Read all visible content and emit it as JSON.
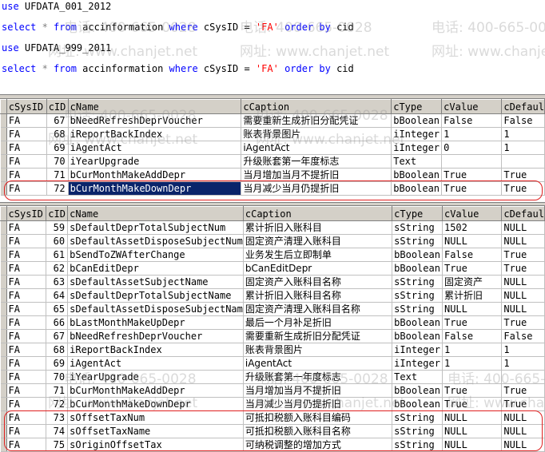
{
  "editor": {
    "lines": [
      {
        "parts": [
          {
            "t": "use",
            "c": "kw"
          },
          {
            "t": " UFDATA_001_2012",
            "c": ""
          }
        ]
      },
      {
        "parts": [
          {
            "t": "select",
            "c": "kw"
          },
          {
            "t": " * ",
            "c": "op"
          },
          {
            "t": "from",
            "c": "kw"
          },
          {
            "t": " accinformation ",
            "c": ""
          },
          {
            "t": "where",
            "c": "kw"
          },
          {
            "t": " cSysID = ",
            "c": ""
          },
          {
            "t": "'FA'",
            "c": "str"
          },
          {
            "t": " ",
            "c": ""
          },
          {
            "t": "order by",
            "c": "kw"
          },
          {
            "t": " cid",
            "c": ""
          }
        ]
      },
      {
        "parts": [
          {
            "t": "use",
            "c": "kw"
          },
          {
            "t": " UFDATA_999_2011",
            "c": ""
          }
        ]
      },
      {
        "parts": [
          {
            "t": "select",
            "c": "kw"
          },
          {
            "t": " * ",
            "c": "op"
          },
          {
            "t": "from",
            "c": "kw"
          },
          {
            "t": " accinformation ",
            "c": ""
          },
          {
            "t": "where",
            "c": "kw"
          },
          {
            "t": " cSysID = ",
            "c": ""
          },
          {
            "t": "'FA'",
            "c": "str"
          },
          {
            "t": " ",
            "c": ""
          },
          {
            "t": "order by",
            "c": "kw"
          },
          {
            "t": " cid",
            "c": ""
          }
        ]
      }
    ]
  },
  "watermark": {
    "phone": "电话: 400-665-0028",
    "site": "网址: www.chanjet.net"
  },
  "columns": [
    "cSysID",
    "cID",
    "cName",
    "cCaption",
    "cType",
    "cValue",
    "cDefaul"
  ],
  "grid1": {
    "rows": [
      [
        "FA",
        "67",
        "bNeedRefreshDeprVoucher",
        "需要重新生成折旧分配凭证",
        "bBoolean",
        "False",
        "False"
      ],
      [
        "FA",
        "68",
        "iReportBackIndex",
        "账表背景图片",
        "iInteger",
        "1",
        "1"
      ],
      [
        "FA",
        "69",
        "iAgentAct",
        "iAgentAct",
        "iInteger",
        "0",
        "1"
      ],
      [
        "FA",
        "70",
        "iYearUpgrade",
        "升级账套第一年度标志",
        "Text",
        "",
        ""
      ],
      [
        "FA",
        "71",
        "bCurMonthMakeAddDepr",
        "当月增加当月不提折旧",
        "bBoolean",
        "True",
        "True"
      ],
      [
        "FA",
        "72",
        "bCurMonthMakeDownDepr",
        "当月减少当月仍提折旧",
        "bBoolean",
        "True",
        "True"
      ]
    ]
  },
  "grid2": {
    "rows": [
      [
        "FA",
        "59",
        "sDefaultDeprTotalSubjectNum",
        "累计折旧入账科目",
        "sString",
        "1502",
        "NULL"
      ],
      [
        "FA",
        "60",
        "sDefaultAssetDisposeSubjectNum",
        "固定资产清理入账科目",
        "sString",
        "NULL",
        "NULL"
      ],
      [
        "FA",
        "61",
        "bSendToZWAfterChange",
        "业务发生后立即制单",
        "bBoolean",
        "False",
        "True"
      ],
      [
        "FA",
        "62",
        "bCanEditDepr",
        "bCanEditDepr",
        "bBoolean",
        "True",
        "True"
      ],
      [
        "FA",
        "63",
        "sDefaultAssetSubjectName",
        "固定资产入账科目名称",
        "sString",
        "固定资产",
        "NULL"
      ],
      [
        "FA",
        "64",
        "sDefaultDeprTotalSubjectName",
        "累计折旧入账科目名称",
        "sString",
        "累计折旧",
        "NULL"
      ],
      [
        "FA",
        "65",
        "sDefaultAssetDisposeSubjectNam",
        "固定资产清理入账科目名称",
        "sString",
        "NULL",
        "NULL"
      ],
      [
        "FA",
        "66",
        "bLastMonthMakeUpDepr",
        "最后一个月补足折旧",
        "bBoolean",
        "True",
        "True"
      ],
      [
        "FA",
        "67",
        "bNeedRefreshDeprVoucher",
        "需要重新生成折旧分配凭证",
        "bBoolean",
        "False",
        "False"
      ],
      [
        "FA",
        "68",
        "iReportBackIndex",
        "账表背景图片",
        "iInteger",
        "1",
        "1"
      ],
      [
        "FA",
        "69",
        "iAgentAct",
        "iAgentAct",
        "iInteger",
        "1",
        "1"
      ],
      [
        "FA",
        "70",
        "iYearUpgrade",
        "升级账套第一年度标志",
        "Text",
        "",
        ""
      ],
      [
        "FA",
        "71",
        "bCurMonthMakeAddDepr",
        "当月增加当月不提折旧",
        "bBoolean",
        "True",
        "True"
      ],
      [
        "FA",
        "72",
        "bCurMonthMakeDownDepr",
        "当月减少当月仍提折旧",
        "bBoolean",
        "True",
        "True"
      ],
      [
        "FA",
        "73",
        "sOffsetTaxNum",
        "可抵扣税额入账科目编码",
        "sString",
        "NULL",
        "NULL"
      ],
      [
        "FA",
        "74",
        "sOffsetTaxName",
        "可抵扣税额入账科目名称",
        "sString",
        "NULL",
        "NULL"
      ],
      [
        "FA",
        "75",
        "sOriginOffsetTax",
        "可纳税调整的增加方式",
        "sString",
        "NULL",
        "NULL"
      ]
    ]
  },
  "colors": {
    "selection": "#0a246a",
    "annotation": "#e02020",
    "keyword": "#0000ff",
    "string": "#ff0000"
  }
}
